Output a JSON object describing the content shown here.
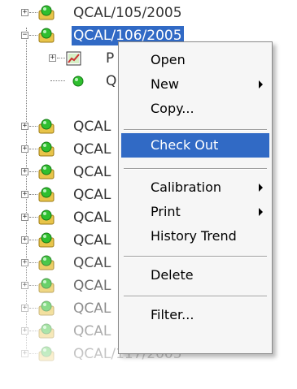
{
  "tree": {
    "items": [
      {
        "label": "QCAL/105/2005",
        "state": "collapsed",
        "selected": false
      },
      {
        "label": "QCAL/106/2005",
        "state": "expanded",
        "selected": true
      },
      {
        "label": "P",
        "state": "collapsed",
        "child": true,
        "icon": "chart-icon"
      },
      {
        "label": "Q",
        "state": "leaf",
        "child": true,
        "icon": "green-dot-icon"
      },
      {
        "label": "QCAL",
        "state": "collapsed"
      },
      {
        "label": "QCAL",
        "state": "collapsed"
      },
      {
        "label": "QCAL",
        "state": "collapsed"
      },
      {
        "label": "QCAL",
        "state": "collapsed"
      },
      {
        "label": "QCAL",
        "state": "collapsed"
      },
      {
        "label": "QCAL",
        "state": "collapsed"
      },
      {
        "label": "QCAL",
        "state": "collapsed"
      },
      {
        "label": "QCAL",
        "state": "collapsed"
      },
      {
        "label": "QCAL",
        "state": "collapsed"
      },
      {
        "label": "QCAL",
        "state": "collapsed"
      },
      {
        "label": "QCAL/117/2005",
        "state": "collapsed"
      }
    ]
  },
  "context_menu": {
    "items": [
      {
        "label": "Open",
        "submenu": false
      },
      {
        "label": "New",
        "submenu": true
      },
      {
        "label": "Copy...",
        "submenu": false
      },
      {
        "label": "Check Out",
        "submenu": false,
        "highlighted": true
      },
      {
        "label": "Calibration",
        "submenu": true
      },
      {
        "label": "Print",
        "submenu": true
      },
      {
        "label": "History Trend",
        "submenu": false
      },
      {
        "label": "Delete",
        "submenu": false
      },
      {
        "label": "Filter...",
        "submenu": false
      }
    ]
  },
  "colors": {
    "selection": "#316ac5",
    "menu_background": "#f6f6f6",
    "icon_green": "#2fbf2f",
    "icon_folder": "#e8c44a"
  }
}
